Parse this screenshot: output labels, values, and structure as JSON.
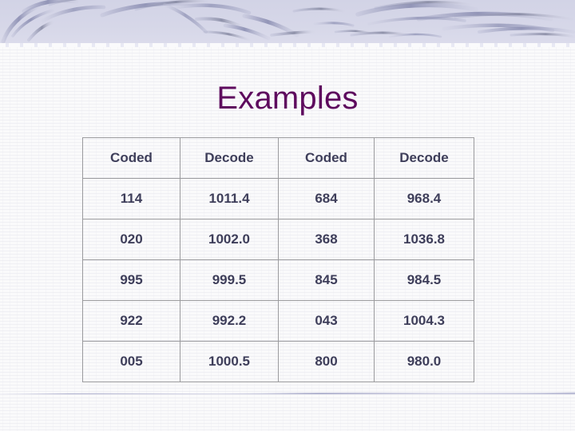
{
  "slide": {
    "title": "Examples",
    "title_color": "#5e0b5e",
    "background_color": "#fafafb",
    "band_color": "#d5d6e8",
    "band_stroke_color": "#8f92b5",
    "accent_line_color": "#b9bbd6",
    "text_color": "#3e3e5a",
    "border_color": "#9b9b9e"
  },
  "table": {
    "headers": [
      "Coded",
      "Decode",
      "Coded",
      "Decode"
    ],
    "rows": [
      [
        "114",
        "1011.4",
        "684",
        "968.4"
      ],
      [
        "020",
        "1002.0",
        "368",
        "1036.8"
      ],
      [
        "995",
        "999.5",
        "845",
        "984.5"
      ],
      [
        "922",
        "992.2",
        "043",
        "1004.3"
      ],
      [
        "005",
        "1000.5",
        "800",
        "980.0"
      ]
    ]
  }
}
